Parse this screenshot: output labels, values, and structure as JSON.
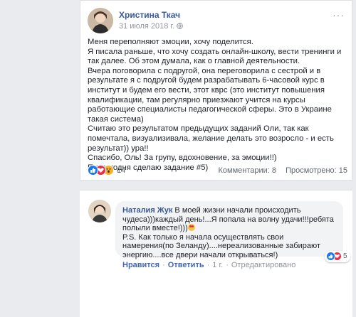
{
  "post": {
    "author": "Христина Ткач",
    "date": "31 июля 2018 г.",
    "icons": {
      "privacy": "globe-icon",
      "menu": "more-options-icon"
    },
    "text": [
      "Меня переполняют эмоции, хочу поделится.",
      "Я писала раньше, что хочу создать онлайн-школу, вести тренинги и так далее. Об этом думала, как о главной деятельности.",
      "Вчера поговорила с подругой, она переговорила с сестрой и в результате я с подругой будем разрабатывать 6-часовой курс в институт и будем его вести, этот кврс (это институт повышения квалификации, там регулярно приезжают учится на курсы работающие специалисты педагогической сферы. Это в Украине такая система)",
      "Считаю это результатом предыдущих заданий Оли, так как помечтала, визуализивала, желание делать это возросло - и есть результат)) ура!!",
      "Спасибо, Оль! За групу, вдохновение, за эмоции!!)",
      "П.с.сегодня сделаю задание #5)"
    ],
    "reactions": {
      "types": [
        "like",
        "love",
        "wow"
      ],
      "count": "14"
    },
    "stats": {
      "comments": "Комментарии: 8",
      "views": "Просмотрено: 15"
    }
  },
  "comment": {
    "author": "Наталия Жук",
    "text_line1": "В моей жизни начали происходить чудеса)))каждый день!...Я попала на волну удачи!!!ребята полыли вместе!)))",
    "text_line2": "P.S. Как только я начала осуществлять свои намерения(по Зеланду)....нереализованные забирают энергию....все двери начали открываться!)",
    "reactions": {
      "types": [
        "like",
        "love"
      ],
      "count": "5"
    },
    "actions": {
      "like": "Нравится",
      "reply": "Ответить",
      "time": "1 г.",
      "edited": "Отредактировано"
    },
    "colors": {
      "link": "#385898",
      "action": "#4267b2",
      "bubble": "#f2f3f5"
    }
  }
}
